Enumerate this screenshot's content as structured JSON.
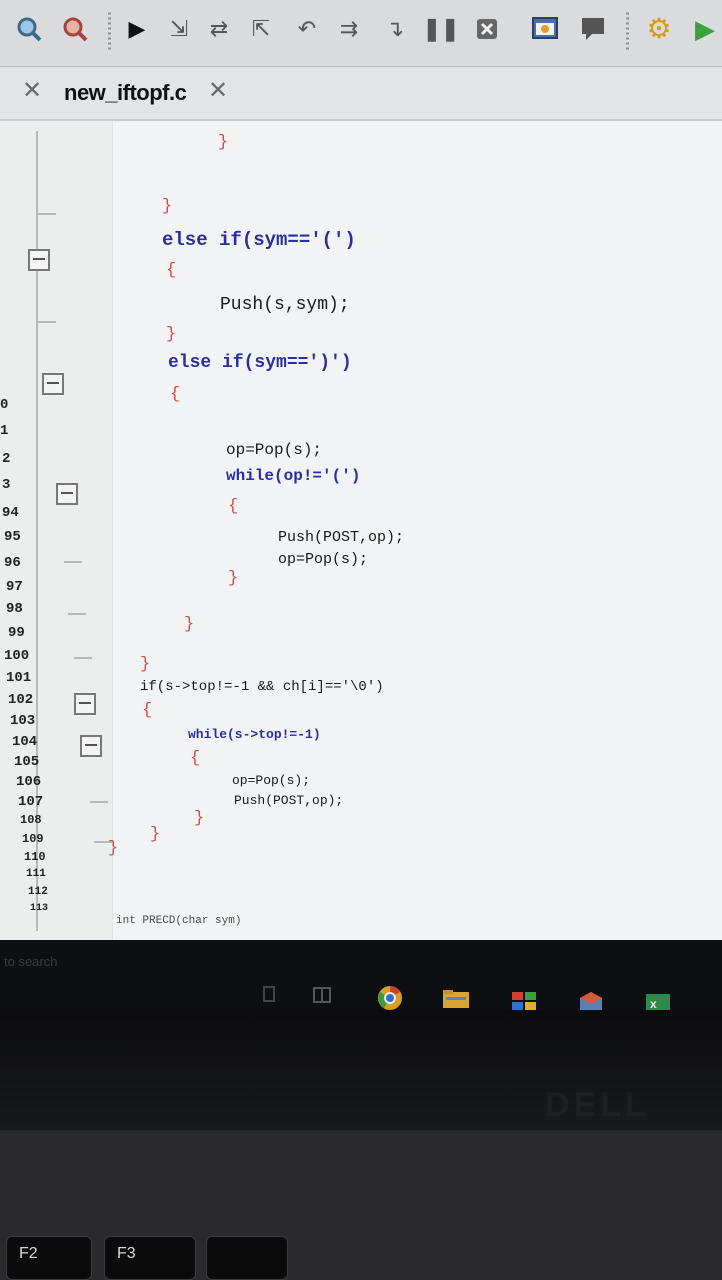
{
  "toolbar": {
    "icons": [
      "search-icon",
      "debug-icon",
      "run-icon",
      "step-into-icon",
      "step-over-icon",
      "step-out-icon",
      "run-to-cursor-icon",
      "continue-icon",
      "step-icon",
      "pause-icon",
      "stop-icon",
      "breakpoint-icon",
      "terminal-icon",
      "settings-icon",
      "play-icon"
    ]
  },
  "tab": {
    "title": "new_iftopf.c"
  },
  "gutter": {
    "line_numbers": [
      "0",
      "1",
      "2",
      "3",
      "94",
      "95",
      "96",
      "97",
      "98",
      "99",
      "100",
      "101",
      "102",
      "103",
      "104",
      "105",
      "106",
      "107",
      "108",
      "109",
      "110",
      "111",
      "112",
      "113"
    ]
  },
  "code": {
    "lines": [
      "}",
      "}",
      "else if(sym=='(')",
      "{",
      "Push(s,sym);",
      "}",
      "else if(sym==')')",
      "{",
      "op=Pop(s);",
      "while(op!='(')",
      "{",
      "Push(POST,op);",
      "op=Pop(s);",
      "}",
      "}",
      "}",
      "if(s->top!=-1 && ch[i]=='\\0')",
      "{",
      "while(s->top!=-1)",
      "{",
      "op=Pop(s);",
      "Push(POST,op);",
      "}",
      "}",
      "}",
      "int PRECD(char sym)"
    ]
  },
  "taskbar": {
    "search_placeholder": "to search"
  },
  "brand": "DELL",
  "keys": {
    "f2": "F2",
    "f3": "F3"
  }
}
